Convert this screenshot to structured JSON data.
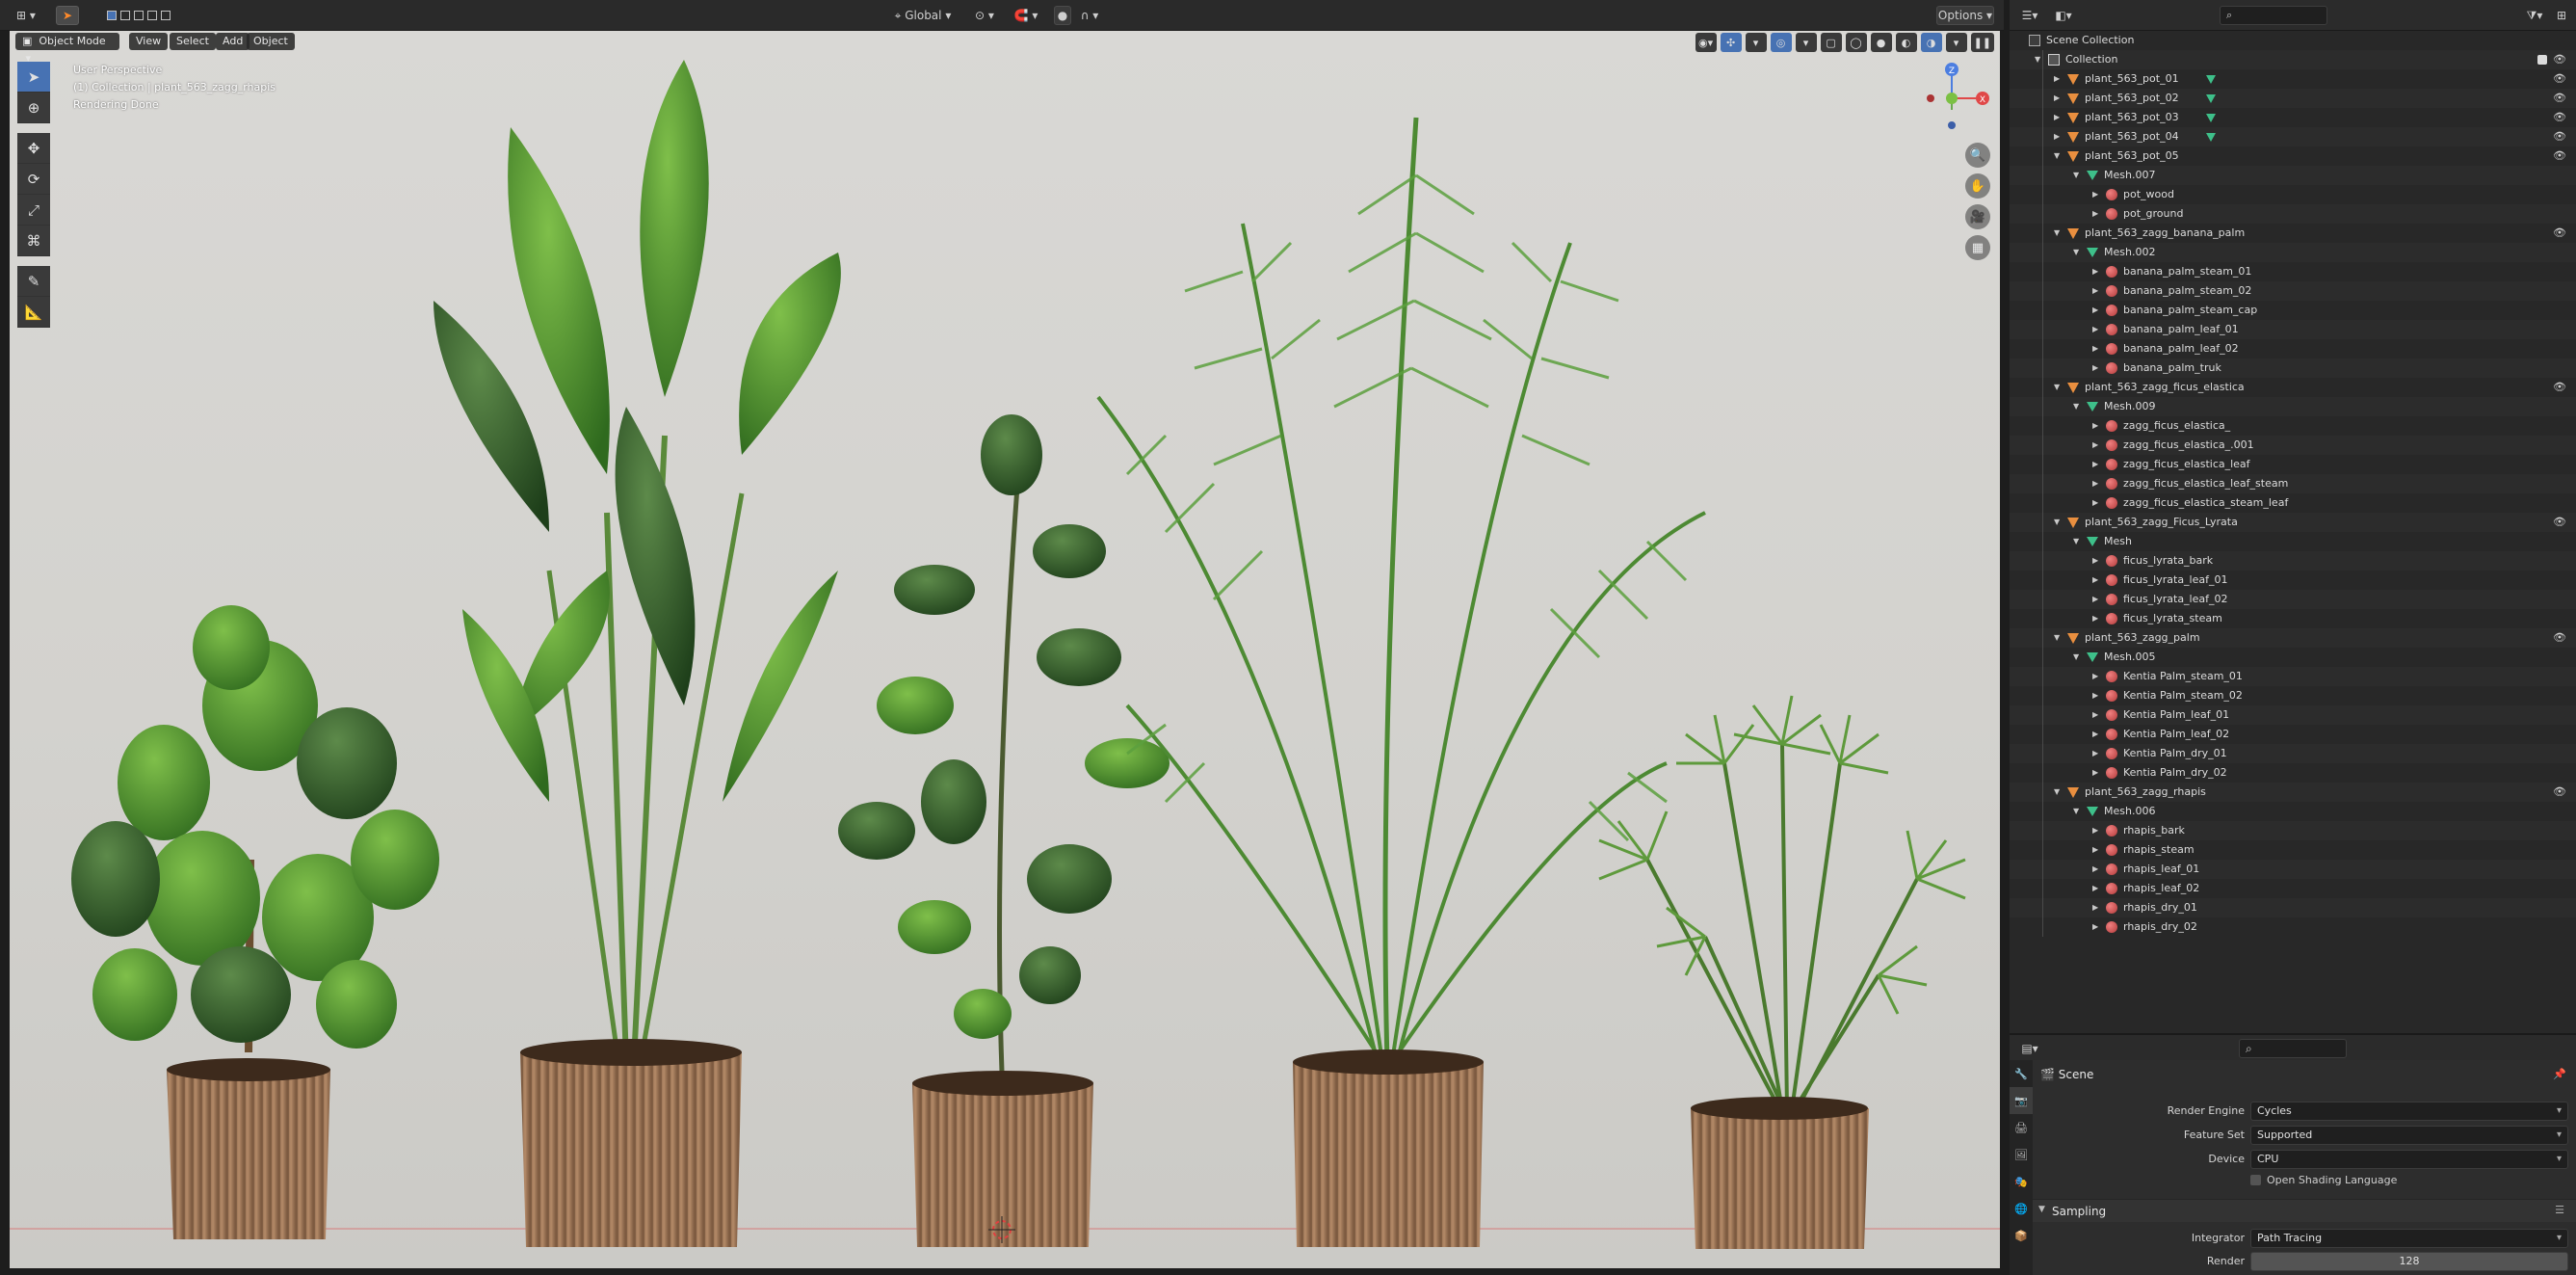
{
  "topbar": {
    "mode": "Object Mode",
    "menus": [
      "View",
      "Select",
      "Add",
      "Object"
    ],
    "transform_orientation": "Global",
    "options": "Options"
  },
  "viewport": {
    "info": [
      "User Perspective",
      "(1) Collection | plant_563_zagg_rhapis",
      "Rendering Done"
    ],
    "gizmo_axes": [
      "Z",
      "X"
    ]
  },
  "outliner": {
    "search_placeholder": "",
    "rows": [
      {
        "label": "Scene Collection",
        "type": "scene",
        "depth": 0
      },
      {
        "label": "Collection",
        "type": "coll",
        "depth": 1,
        "open": true
      },
      {
        "label": "plant_563_pot_01",
        "type": "obj",
        "depth": 2,
        "mod": true
      },
      {
        "label": "plant_563_pot_02",
        "type": "obj",
        "depth": 2,
        "mod": true
      },
      {
        "label": "plant_563_pot_03",
        "type": "obj",
        "depth": 2,
        "mod": true
      },
      {
        "label": "plant_563_pot_04",
        "type": "obj",
        "depth": 2,
        "mod": true
      },
      {
        "label": "plant_563_pot_05",
        "type": "obj",
        "depth": 2,
        "open": true
      },
      {
        "label": "Mesh.007",
        "type": "mesh",
        "depth": 3,
        "open": true
      },
      {
        "label": "pot_wood",
        "type": "mat",
        "depth": 4
      },
      {
        "label": "pot_ground",
        "type": "mat",
        "depth": 4
      },
      {
        "label": "plant_563_zagg_banana_palm",
        "type": "obj",
        "depth": 2,
        "open": true
      },
      {
        "label": "Mesh.002",
        "type": "mesh",
        "depth": 3,
        "open": true
      },
      {
        "label": "banana_palm_steam_01",
        "type": "mat",
        "depth": 4
      },
      {
        "label": "banana_palm_steam_02",
        "type": "mat",
        "depth": 4
      },
      {
        "label": "banana_palm_steam_cap",
        "type": "mat",
        "depth": 4
      },
      {
        "label": "banana_palm_leaf_01",
        "type": "mat",
        "depth": 4
      },
      {
        "label": "banana_palm_leaf_02",
        "type": "mat",
        "depth": 4
      },
      {
        "label": "banana_palm_truk",
        "type": "mat",
        "depth": 4
      },
      {
        "label": "plant_563_zagg_ficus_elastica",
        "type": "obj",
        "depth": 2,
        "open": true
      },
      {
        "label": "Mesh.009",
        "type": "mesh",
        "depth": 3,
        "open": true
      },
      {
        "label": "zagg_ficus_elastica_",
        "type": "mat",
        "depth": 4
      },
      {
        "label": "zagg_ficus_elastica_.001",
        "type": "mat",
        "depth": 4
      },
      {
        "label": "zagg_ficus_elastica_leaf",
        "type": "mat",
        "depth": 4
      },
      {
        "label": "zagg_ficus_elastica_leaf_steam",
        "type": "mat",
        "depth": 4
      },
      {
        "label": "zagg_ficus_elastica_steam_leaf",
        "type": "mat",
        "depth": 4
      },
      {
        "label": "plant_563_zagg_Ficus_Lyrata",
        "type": "obj",
        "depth": 2,
        "open": true
      },
      {
        "label": "Mesh",
        "type": "mesh",
        "depth": 3,
        "open": true
      },
      {
        "label": "ficus_lyrata_bark",
        "type": "mat",
        "depth": 4
      },
      {
        "label": "ficus_lyrata_leaf_01",
        "type": "mat",
        "depth": 4
      },
      {
        "label": "ficus_lyrata_leaf_02",
        "type": "mat",
        "depth": 4
      },
      {
        "label": "ficus_lyrata_steam",
        "type": "mat",
        "depth": 4
      },
      {
        "label": "plant_563_zagg_palm",
        "type": "obj",
        "depth": 2,
        "open": true
      },
      {
        "label": "Mesh.005",
        "type": "mesh",
        "depth": 3,
        "open": true
      },
      {
        "label": "Kentia Palm_steam_01",
        "type": "mat",
        "depth": 4
      },
      {
        "label": "Kentia Palm_steam_02",
        "type": "mat",
        "depth": 4
      },
      {
        "label": "Kentia Palm_leaf_01",
        "type": "mat",
        "depth": 4
      },
      {
        "label": "Kentia Palm_leaf_02",
        "type": "mat",
        "depth": 4
      },
      {
        "label": "Kentia Palm_dry_01",
        "type": "mat",
        "depth": 4
      },
      {
        "label": "Kentia Palm_dry_02",
        "type": "mat",
        "depth": 4
      },
      {
        "label": "plant_563_zagg_rhapis",
        "type": "obj",
        "depth": 2,
        "open": true
      },
      {
        "label": "Mesh.006",
        "type": "mesh",
        "depth": 3,
        "open": true
      },
      {
        "label": "rhapis_bark",
        "type": "mat",
        "depth": 4
      },
      {
        "label": "rhapis_steam",
        "type": "mat",
        "depth": 4
      },
      {
        "label": "rhapis_leaf_01",
        "type": "mat",
        "depth": 4
      },
      {
        "label": "rhapis_leaf_02",
        "type": "mat",
        "depth": 4
      },
      {
        "label": "rhapis_dry_01",
        "type": "mat",
        "depth": 4
      },
      {
        "label": "rhapis_dry_02",
        "type": "mat",
        "depth": 4
      }
    ]
  },
  "properties": {
    "context": "Scene",
    "render_engine_label": "Render Engine",
    "render_engine": "Cycles",
    "feature_set_label": "Feature Set",
    "feature_set": "Supported",
    "device_label": "Device",
    "device": "CPU",
    "osl_label": "Open Shading Language",
    "sampling_label": "Sampling",
    "integrator_label": "Integrator",
    "integrator": "Path Tracing",
    "render_label": "Render",
    "render_samples": "128"
  },
  "colors": {
    "accent": "#4772b3",
    "object_icon": "#e98f3f",
    "mesh_icon": "#3ec08a",
    "material_icon": "#d05050"
  }
}
